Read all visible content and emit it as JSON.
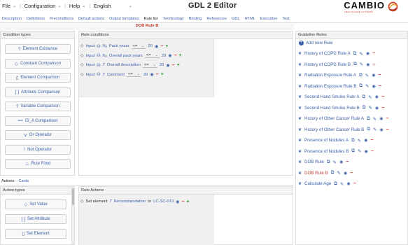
{
  "menu": {
    "file": "File",
    "configuration": "Configuration",
    "help": "Help",
    "language": "English"
  },
  "app_title": "GDL 2 Editor",
  "brand": {
    "name": "CAMBIO",
    "tagline": "HEALTHCARE SYSTEMS"
  },
  "tabs": [
    "Description",
    "Definitions",
    "Preconditions",
    "Default actions",
    "Output templates",
    "Rule list",
    "Terminology",
    "Binding",
    "References",
    "GDL",
    "HTML",
    "Execution",
    "Test"
  ],
  "active_rule": "DOB Rule B",
  "condition_types": {
    "header": "Condition types",
    "buttons": [
      {
        "icon": "?",
        "label": "Element Existence"
      },
      {
        "icon": "◇",
        "label": "Constant Comparison"
      },
      {
        "icon": "▯",
        "label": "Element Comparison"
      },
      {
        "icon": "[ ]",
        "label": "Attribute Comparison"
      },
      {
        "icon": "?",
        "label": "Variable Comparison"
      },
      {
        "icon": "==",
        "label": "IS_A Comparison"
      },
      {
        "icon": "∨",
        "label": "Or Operator"
      },
      {
        "icon": "!",
        "label": "Not Operator"
      },
      {
        "icon": "♨",
        "label": "Rule Fired"
      }
    ]
  },
  "rule_conditions": {
    "header": "Rule conditions",
    "rows": [
      {
        "input": "Input",
        "type": "N₀",
        "name": "Pack years",
        "operator": "<=",
        "value": "20",
        "plus": true
      },
      {
        "input": "Input",
        "type": "N₀",
        "name": "Overall pack years",
        "operator": "<=",
        "value": "20",
        "plus": true
      },
      {
        "input": "Input",
        "type": "T",
        "name": "Overall description",
        "operator": "<=",
        "value": "20",
        "plus": true
      },
      {
        "input": "Input",
        "type": "T",
        "name": "Comment",
        "operator": "<=",
        "value": "20",
        "plus": true
      }
    ]
  },
  "bottom_tabs": [
    "Actions",
    "Cards"
  ],
  "action_types": {
    "header": "Action types",
    "buttons": [
      {
        "icon": "◇",
        "label": "Set Value"
      },
      {
        "icon": "[ ]",
        "label": "Set Attribute"
      },
      {
        "icon": "▯",
        "label": "Set Element"
      }
    ]
  },
  "rule_actions": {
    "header": "Rule Actions",
    "rows": [
      {
        "prefix": "Set element",
        "type": "T",
        "name": "Recommendation",
        "to": "to",
        "value": "LC-SC-013"
      }
    ]
  },
  "guideline_rules": {
    "header": "Guideline Rules",
    "add_label": "Add new Rule",
    "items": [
      "History of COPD Rule A",
      "History of COPD Rule B",
      "Radiation Exposure Rule A",
      "Radiation Exposure Rule B",
      "Second Hand Smoke Rule A",
      "Second Hand Smoke Rule B",
      "History of Other Cancer Rule A",
      "History of Other Cancer Rule B",
      "Presence of Nodules A",
      "Presence of Nodules B",
      "DOB Rule",
      "DOB Rule B",
      "Calculate Age"
    ],
    "highlighted": "DOB Rule B"
  },
  "colors": {
    "accent_blue": "#3a5fa8",
    "rule_red": "#c0392b",
    "plus_green": "#2a9a2a",
    "minus_red": "#dd2222"
  }
}
